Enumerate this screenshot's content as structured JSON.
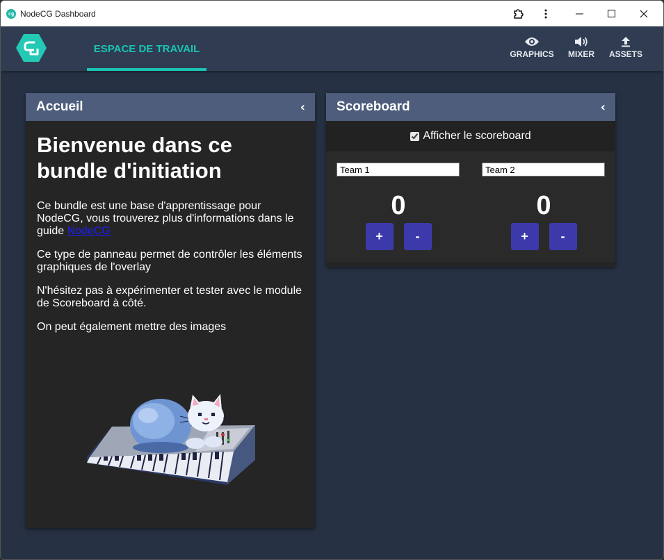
{
  "window": {
    "title": "NodeCG Dashboard"
  },
  "topnav": {
    "tab_label": "ESPACE DE TRAVAIL",
    "actions": [
      {
        "label": "GRAPHICS",
        "icon": "eye-icon"
      },
      {
        "label": "MIXER",
        "icon": "volume-icon"
      },
      {
        "label": "ASSETS",
        "icon": "upload-icon"
      }
    ]
  },
  "accueil": {
    "header": "Accueil",
    "heading": "Bienvenue dans ce bundle d'initiation",
    "p1_text": "Ce bundle est une base d'apprentissage pour NodeCG, vous trouverez plus d'informations dans le guide ",
    "p1_link": "NodeCG",
    "p2": "Ce type de panneau permet de contrôler les éléments graphiques de l'overlay",
    "p3": "N'hésitez pas à expérimenter et tester avec le module de Scoreboard à côté.",
    "p4": "On peut également mettre des images"
  },
  "scoreboard": {
    "header": "Scoreboard",
    "checkbox_label": "Afficher le scoreboard",
    "checkbox_checked": true,
    "teams": [
      {
        "name": "Team 1",
        "score": "0",
        "plus": "+",
        "minus": "-"
      },
      {
        "name": "Team 2",
        "score": "0",
        "plus": "+",
        "minus": "-"
      }
    ]
  },
  "colors": {
    "accent": "#1ac4b4",
    "nav_bg": "#2f3c52",
    "page_bg": "#263244",
    "panel_header": "#4d5d7b",
    "button": "#3c3aab"
  }
}
